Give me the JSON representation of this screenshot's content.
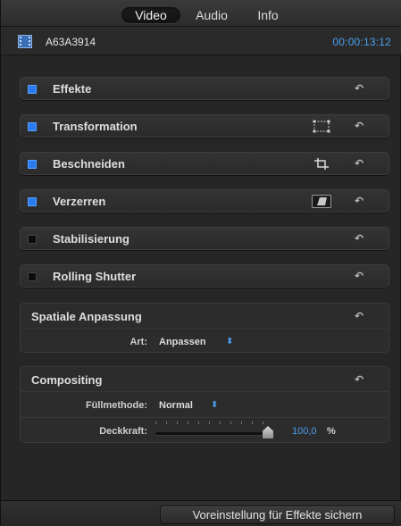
{
  "tabs": [
    {
      "label": "Video",
      "active": true
    },
    {
      "label": "Audio",
      "active": false
    },
    {
      "label": "Info",
      "active": false
    }
  ],
  "header": {
    "clip_name": "A63A3914",
    "timecode": "00:00:13:12"
  },
  "effects": [
    {
      "label": "Effekte",
      "enabled": true,
      "onscreen_icon": null
    },
    {
      "label": "Transformation",
      "enabled": true,
      "onscreen_icon": "transform-handles-icon"
    },
    {
      "label": "Beschneiden",
      "enabled": true,
      "onscreen_icon": "crop-icon"
    },
    {
      "label": "Verzerren",
      "enabled": true,
      "onscreen_icon": "distort-icon"
    },
    {
      "label": "Stabilisierung",
      "enabled": false,
      "onscreen_icon": null
    },
    {
      "label": "Rolling Shutter",
      "enabled": false,
      "onscreen_icon": null
    }
  ],
  "spatial": {
    "title": "Spatiale Anpassung",
    "art_label": "Art:",
    "art_value": "Anpassen",
    "stepper_symbol": "⬍"
  },
  "compositing": {
    "title": "Compositing",
    "blend_label": "Füllmethode:",
    "blend_value": "Normal",
    "stepper_symbol": "⬍",
    "opacity_label": "Deckkraft:",
    "opacity_value": "100,0",
    "opacity_unit": "%",
    "opacity_fraction": 1.0
  },
  "reset_symbol": "↶",
  "footer": {
    "save_label": "Voreinstellung für Effekte sichern"
  },
  "colors": {
    "accent": "#4aa0f0",
    "checkbox_on": "#2a7bf0",
    "background": "#262626"
  }
}
